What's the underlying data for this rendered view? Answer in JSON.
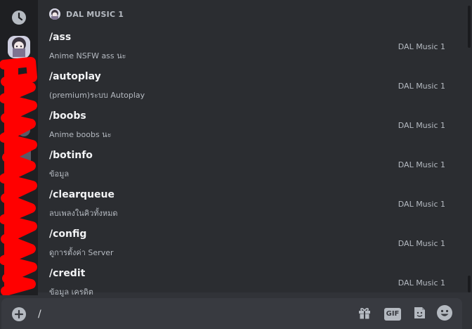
{
  "panel": {
    "title": "DAL MUSIC 1"
  },
  "commands": [
    {
      "name": "/ass",
      "desc": "Anime NSFW ass นะ",
      "source": "DAL Music 1"
    },
    {
      "name": "/autoplay",
      "desc": "(premium)ระบบ Autoplay",
      "source": "DAL Music 1"
    },
    {
      "name": "/boobs",
      "desc": "Anime boobs นะ",
      "source": "DAL Music 1"
    },
    {
      "name": "/botinfo",
      "desc": "ข้อมูล",
      "source": "DAL Music 1"
    },
    {
      "name": "/clearqueue",
      "desc": "ลบเพลงในคิวทั้งหมด",
      "source": "DAL Music 1"
    },
    {
      "name": "/config",
      "desc": "ดูการตั้งค่า Server",
      "source": "DAL Music 1"
    },
    {
      "name": "/credit",
      "desc": "ข้อมูล เครดิต",
      "source": "DAL Music 1"
    }
  ],
  "composer": {
    "value": "/"
  },
  "icons": {
    "rail": [
      "clock-icon",
      "bot-avatar"
    ],
    "composer": [
      "add-icon",
      "gift-icon",
      "gif-icon",
      "sticker-icon",
      "emoji-icon"
    ]
  },
  "gif_label": "GIF",
  "colors": {
    "background": "#313338",
    "panel": "#2b2d31",
    "rail": "#1e1f22",
    "composer": "#383a40",
    "text_primary": "#f2f3f5",
    "text_secondary": "#b5bac1",
    "redaction": "#ff0000"
  }
}
